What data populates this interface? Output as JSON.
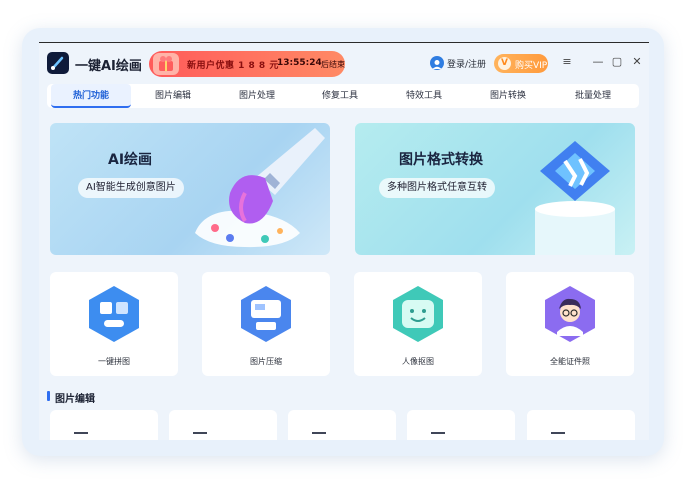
{
  "app": {
    "title": "一键AI绘画"
  },
  "promo": {
    "text": "新用户优惠 1 8 8 元",
    "time": "13:55:24",
    "suffix": "后结束"
  },
  "header": {
    "login": "登录/注册",
    "vip": "购买VIP",
    "vip_icon": "V"
  },
  "window_controls": {
    "menu": "≡",
    "minimize": "—",
    "maximize": "▢",
    "close": "✕"
  },
  "tabs": [
    {
      "label": "热门功能",
      "active": true
    },
    {
      "label": "图片编辑"
    },
    {
      "label": "图片处理"
    },
    {
      "label": "修复工具"
    },
    {
      "label": "特效工具"
    },
    {
      "label": "图片转换"
    },
    {
      "label": "批量处理"
    }
  ],
  "banners": [
    {
      "title": "AI绘画",
      "subtitle": "AI智能生成创意图片"
    },
    {
      "title": "图片格式转换",
      "subtitle": "多种图片格式任意互转"
    }
  ],
  "features": [
    {
      "label": "一键拼图",
      "color": "#3d8df0"
    },
    {
      "label": "图片压缩",
      "color": "#4a86ee"
    },
    {
      "label": "人像抠图",
      "color": "#3fc9b8"
    },
    {
      "label": "全能证件照",
      "color": "#8b6cf0"
    }
  ],
  "section": {
    "title": "图片编辑"
  }
}
